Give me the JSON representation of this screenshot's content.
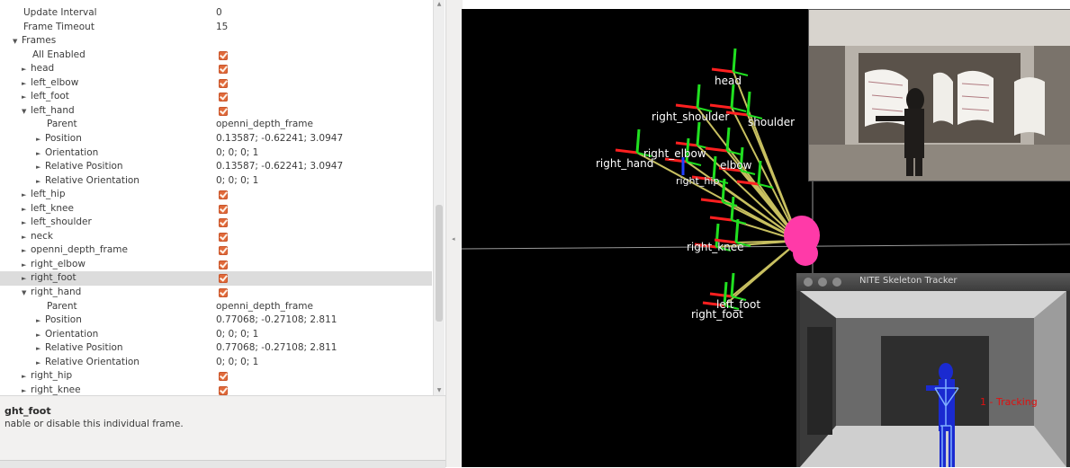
{
  "properties": [
    {
      "label": "Update Interval",
      "indent": 1,
      "value": "0"
    },
    {
      "label": "Frame Timeout",
      "indent": 1,
      "value": "15"
    },
    {
      "label": "Frames",
      "indent": 1,
      "arrow": "open"
    },
    {
      "label": "All Enabled",
      "indent": 2,
      "check": true
    },
    {
      "label": "head",
      "indent": 2,
      "arrow": "closed",
      "check": true
    },
    {
      "label": "left_elbow",
      "indent": 2,
      "arrow": "closed",
      "check": true
    },
    {
      "label": "left_foot",
      "indent": 2,
      "arrow": "closed",
      "check": true
    },
    {
      "label": "left_hand",
      "indent": 2,
      "arrow": "open",
      "check": true
    },
    {
      "label": "Parent",
      "indent": 3,
      "value": "openni_depth_frame"
    },
    {
      "label": "Position",
      "indent": 3,
      "arrow": "closed",
      "value": "0.13587; -0.62241; 3.0947"
    },
    {
      "label": "Orientation",
      "indent": 3,
      "arrow": "closed",
      "value": "0; 0; 0; 1"
    },
    {
      "label": "Relative Position",
      "indent": 3,
      "arrow": "closed",
      "value": "0.13587; -0.62241; 3.0947"
    },
    {
      "label": "Relative Orientation",
      "indent": 3,
      "arrow": "closed",
      "value": "0; 0; 0; 1"
    },
    {
      "label": "left_hip",
      "indent": 2,
      "arrow": "closed",
      "check": true
    },
    {
      "label": "left_knee",
      "indent": 2,
      "arrow": "closed",
      "check": true
    },
    {
      "label": "left_shoulder",
      "indent": 2,
      "arrow": "closed",
      "check": true
    },
    {
      "label": "neck",
      "indent": 2,
      "arrow": "closed",
      "check": true
    },
    {
      "label": "openni_depth_frame",
      "indent": 2,
      "arrow": "closed",
      "check": true
    },
    {
      "label": "right_elbow",
      "indent": 2,
      "arrow": "closed",
      "check": true
    },
    {
      "label": "right_foot",
      "indent": 2,
      "arrow": "closed",
      "check": true,
      "selected": true
    },
    {
      "label": "right_hand",
      "indent": 2,
      "arrow": "open",
      "check": true
    },
    {
      "label": "Parent",
      "indent": 3,
      "value": "openni_depth_frame"
    },
    {
      "label": "Position",
      "indent": 3,
      "arrow": "closed",
      "value": "0.77068; -0.27108; 2.811"
    },
    {
      "label": "Orientation",
      "indent": 3,
      "arrow": "closed",
      "value": "0; 0; 0; 1"
    },
    {
      "label": "Relative Position",
      "indent": 3,
      "arrow": "closed",
      "value": "0.77068; -0.27108; 2.811"
    },
    {
      "label": "Relative Orientation",
      "indent": 3,
      "arrow": "closed",
      "value": "0; 0; 0; 1"
    },
    {
      "label": "right_hip",
      "indent": 2,
      "arrow": "closed",
      "check": true
    },
    {
      "label": "right_knee",
      "indent": 2,
      "arrow": "closed",
      "check": true
    }
  ],
  "description": {
    "title": "ght_foot",
    "text": "nable or disable this individual frame."
  },
  "joint_labels": {
    "head": "head",
    "right_shoulder": "right_shoulder",
    "shoulder": "shoulder",
    "right_elbow": "right_elbow",
    "right_hand": "right_hand",
    "elbow": "elbow",
    "right_hip": "right_hip",
    "right_knee": "right_knee",
    "left_foot": "left_foot",
    "right_foot": "right_foot"
  },
  "nite": {
    "title": "NITE Skeleton Tracker",
    "status": "1 - Tracking"
  },
  "icons": {
    "expanded": "▼",
    "collapsed": "►",
    "checkbox": "checked-box-icon"
  },
  "colors": {
    "checkbox": "#e06a3b",
    "tf_x": "#ff2020",
    "tf_y": "#20e020",
    "tf_z": "#2040ff",
    "tf_link": "#c8c060",
    "origin": "#ff3aa8",
    "skeleton": "#1020c8"
  }
}
